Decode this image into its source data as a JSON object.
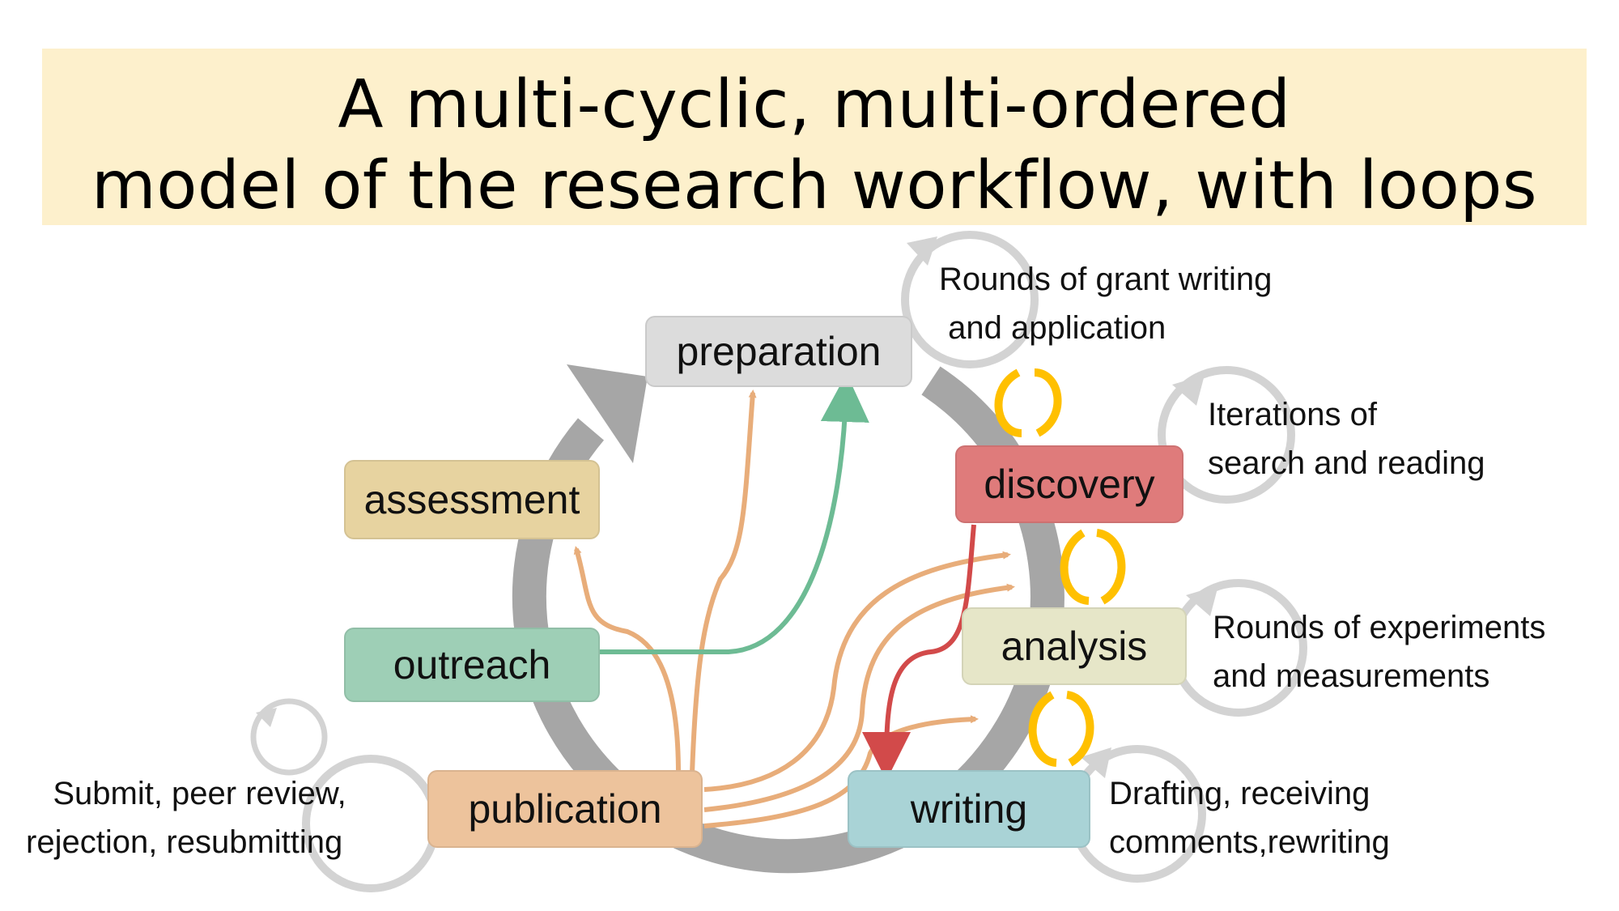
{
  "title": {
    "line1": "A multi-cyclic, multi-ordered",
    "line2": "model of the research workflow, with loops",
    "background": "#fdf0cc"
  },
  "nodes": {
    "preparation": {
      "label": "preparation",
      "color": "#dcdcdc"
    },
    "discovery": {
      "label": "discovery",
      "color": "#df7b7b"
    },
    "analysis": {
      "label": "analysis",
      "color": "#e6e6c8"
    },
    "writing": {
      "label": "writing",
      "color": "#a9d3d6"
    },
    "publication": {
      "label": "publication",
      "color": "#edc39c"
    },
    "outreach": {
      "label": "outreach",
      "color": "#9ecfb6"
    },
    "assessment": {
      "label": "assessment",
      "color": "#e7d3a0"
    }
  },
  "notes": {
    "preparation": "Rounds of grant writing\n and application",
    "discovery": "Iterations of\nsearch and reading",
    "analysis": "Rounds of experiments\nand measurements",
    "writing": "Drafting, receiving\ncomments,rewriting",
    "publication": "   Submit, peer review,\nrejection, resubmitting"
  },
  "colors": {
    "main_cycle": "#a6a6a6",
    "loop_circle": "#d3d3d3",
    "loop_arrow": "#bfbfbf",
    "yellow_exchange": "#ffc000",
    "publication_arrow": "#e8ad7a",
    "outreach_arrow": "#6dbb94",
    "discovery_arrow": "#d24a4a"
  },
  "edges": [
    {
      "from": "publication",
      "to": "assessment",
      "color_key": "publication_arrow"
    },
    {
      "from": "publication",
      "to": "preparation",
      "color_key": "publication_arrow"
    },
    {
      "from": "outreach",
      "to": "preparation",
      "color_key": "outreach_arrow"
    },
    {
      "from": "publication",
      "to": "discovery",
      "color_key": "publication_arrow"
    },
    {
      "from": "publication",
      "to": "analysis",
      "color_key": "publication_arrow"
    },
    {
      "from": "publication",
      "to": "writing",
      "color_key": "publication_arrow"
    },
    {
      "from": "discovery",
      "to": "writing",
      "color_key": "discovery_arrow"
    }
  ]
}
